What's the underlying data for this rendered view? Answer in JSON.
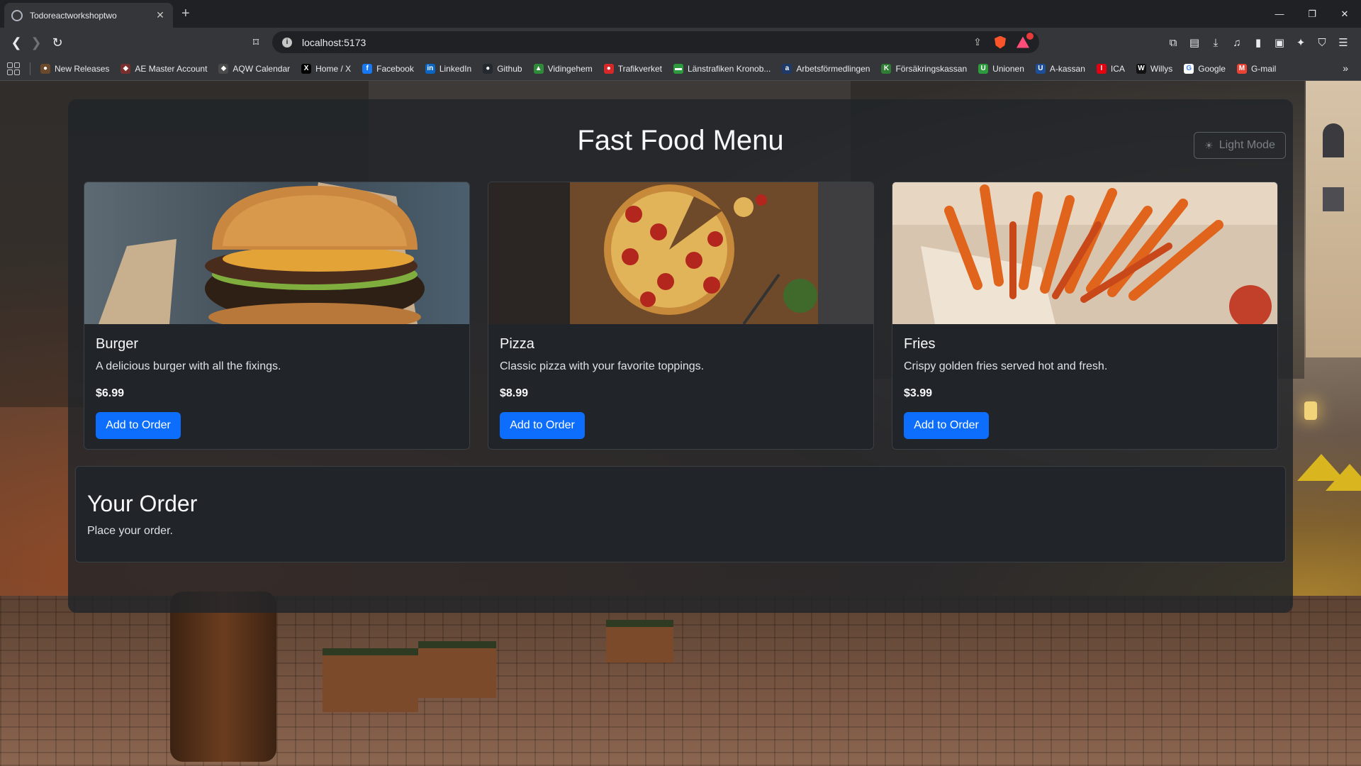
{
  "browser": {
    "tab_title": "Todoreactworkshoptwo",
    "url": "localhost:5173",
    "bookmarks": [
      {
        "label": "New Releases",
        "color": "#6b4a2b",
        "glyph": "●"
      },
      {
        "label": "AE Master Account",
        "color": "#7a2f2f",
        "glyph": "◆"
      },
      {
        "label": "AQW Calendar",
        "color": "#4a4a4a",
        "glyph": "◆"
      },
      {
        "label": "Home / X",
        "color": "#000000",
        "glyph": "X"
      },
      {
        "label": "Facebook",
        "color": "#1877f2",
        "glyph": "f"
      },
      {
        "label": "LinkedIn",
        "color": "#0a66c2",
        "glyph": "in"
      },
      {
        "label": "Github",
        "color": "#24292f",
        "glyph": "●"
      },
      {
        "label": "Vidingehem",
        "color": "#2f8a3a",
        "glyph": "▲"
      },
      {
        "label": "Trafikverket",
        "color": "#d62828",
        "glyph": "●"
      },
      {
        "label": "Länstrafiken Kronob...",
        "color": "#2e9a3e",
        "glyph": "▬"
      },
      {
        "label": "Arbetsförmedlingen",
        "color": "#1d3a6b",
        "glyph": "a"
      },
      {
        "label": "Försäkringskassan",
        "color": "#2e7d32",
        "glyph": "K"
      },
      {
        "label": "Unionen",
        "color": "#2e9a3e",
        "glyph": "U"
      },
      {
        "label": "A-kassan",
        "color": "#1d4e9a",
        "glyph": "U"
      },
      {
        "label": "ICA",
        "color": "#e3000f",
        "glyph": "I"
      },
      {
        "label": "Willys",
        "color": "#111111",
        "glyph": "W"
      },
      {
        "label": "Google",
        "color": "#ffffff",
        "glyph": "G"
      },
      {
        "label": "G-mail",
        "color": "#ea4335",
        "glyph": "M"
      }
    ]
  },
  "app": {
    "title": "Fast Food Menu",
    "mode_button": "Light Mode",
    "add_label": "Add to Order",
    "items": [
      {
        "name": "Burger",
        "description": "A delicious burger with all the fixings.",
        "price": "$6.99"
      },
      {
        "name": "Pizza",
        "description": "Classic pizza with your favorite toppings.",
        "price": "$8.99"
      },
      {
        "name": "Fries",
        "description": "Crispy golden fries served hot and fresh.",
        "price": "$3.99"
      }
    ],
    "order": {
      "title": "Your Order",
      "subtitle": "Place your order."
    }
  },
  "colors": {
    "primary_button": "#0d6efd",
    "panel": "#212529"
  }
}
